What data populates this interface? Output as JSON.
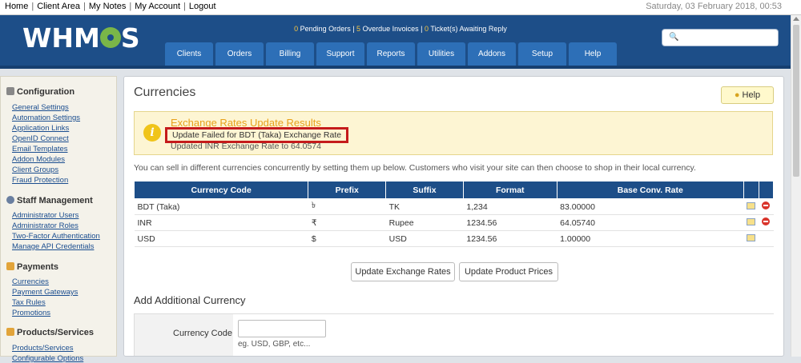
{
  "topbar": {
    "links": [
      "Home",
      "Client Area",
      "My Notes",
      "My Account",
      "Logout"
    ],
    "date": "Saturday, 03 February 2018, 00:53"
  },
  "header": {
    "logo_left": "WHM",
    "logo_right": "S",
    "stats": {
      "pending_orders_count": "0",
      "pending_orders_label": "Pending Orders",
      "overdue_count": "5",
      "overdue_label": "Overdue Invoices",
      "tickets_count": "0",
      "tickets_label": "Ticket(s) Awaiting Reply"
    },
    "search_placeholder": "",
    "nav": [
      "Clients",
      "Orders",
      "Billing",
      "Support",
      "Reports",
      "Utilities",
      "Addons",
      "Setup",
      "Help"
    ]
  },
  "sidebar": {
    "sections": [
      {
        "title": "Configuration",
        "links": [
          "General Settings",
          "Automation Settings",
          "Application Links",
          "OpenID Connect",
          "Email Templates",
          "Addon Modules",
          "Client Groups",
          "Fraud Protection"
        ]
      },
      {
        "title": "Staff Management",
        "links": [
          "Administrator Users",
          "Administrator Roles",
          "Two-Factor Authentication",
          "Manage API Credentials"
        ]
      },
      {
        "title": "Payments",
        "links": [
          "Currencies",
          "Payment Gateways",
          "Tax Rules",
          "Promotions"
        ]
      },
      {
        "title": "Products/Services",
        "links": [
          "Products/Services",
          "Configurable Options"
        ]
      }
    ]
  },
  "main": {
    "title": "Currencies",
    "help_label": "Help",
    "alert": {
      "title": "Exchange Rates Update Results",
      "line1": "Update Failed for BDT (Taka) Exchange Rate",
      "line2": "Updated INR Exchange Rate to 64.0574"
    },
    "intro": "You can sell in different currencies concurrently by setting them up below. Customers who visit your site can then choose to shop in their local currency.",
    "table": {
      "headers": [
        "Currency Code",
        "Prefix",
        "Suffix",
        "Format",
        "Base Conv. Rate"
      ],
      "rows": [
        {
          "code": "BDT (Taka)",
          "prefix": "৳",
          "suffix": "TK",
          "format": "1,234",
          "rate": "83.00000"
        },
        {
          "code": "INR",
          "prefix": "₹",
          "suffix": "Rupee",
          "format": "1234.56",
          "rate": "64.05740"
        },
        {
          "code": "USD",
          "prefix": "$",
          "suffix": "USD",
          "format": "1234.56",
          "rate": "1.00000"
        }
      ]
    },
    "buttons": {
      "update_rates": "Update Exchange Rates",
      "update_prices": "Update Product Prices"
    },
    "add_section_title": "Add Additional Currency",
    "form": {
      "currency_code_label": "Currency Code",
      "currency_code_value": "",
      "currency_code_hint": "eg. USD, GBP, etc..."
    }
  },
  "colors": {
    "header_bg": "#1d4e88",
    "nav_tab": "#2d6fb7",
    "alert_bg": "#fdf5d3",
    "alert_title": "#e8a11a",
    "highlight_border": "#c51b1b"
  }
}
